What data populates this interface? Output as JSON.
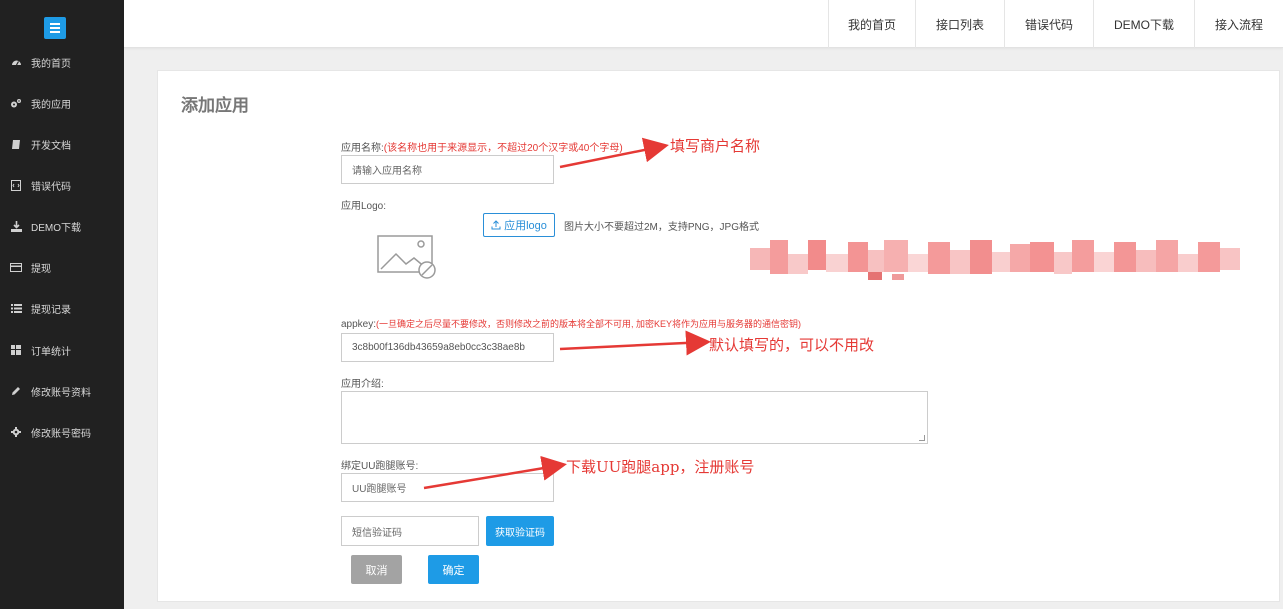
{
  "sidebar": {
    "items": [
      {
        "label": "我的首页",
        "icon": "dashboard-icon"
      },
      {
        "label": "我的应用",
        "icon": "cogs-icon"
      },
      {
        "label": "开发文档",
        "icon": "book-icon"
      },
      {
        "label": "错误代码",
        "icon": "code-file-icon"
      },
      {
        "label": "DEMO下载",
        "icon": "download-icon"
      },
      {
        "label": "提现",
        "icon": "credit-card-icon"
      },
      {
        "label": "提现记录",
        "icon": "list-icon"
      },
      {
        "label": "订单统计",
        "icon": "grid-icon"
      },
      {
        "label": "修改账号资料",
        "icon": "pencil-icon"
      },
      {
        "label": "修改账号密码",
        "icon": "gear-icon"
      }
    ]
  },
  "topnav": {
    "items": [
      "我的首页",
      "接口列表",
      "错误代码",
      "DEMO下载",
      "接入流程"
    ]
  },
  "page": {
    "title": "添加应用"
  },
  "form": {
    "app_name": {
      "label": "应用名称:",
      "note": "(该名称也用于来源显示，不超过20个汉字或40个字母)",
      "placeholder": "请输入应用名称"
    },
    "logo": {
      "label": "应用Logo:",
      "button": "应用logo",
      "hint": "图片大小不要超过2M，支持PNG，JPG格式"
    },
    "appkey": {
      "label": "appkey:",
      "note": "(一旦确定之后尽量不要修改，否则修改之前的版本将全部不可用, 加密KEY将作为应用与服务器的通信密钥)",
      "value": "3c8b00f136db43659a8eb0cc3c38ae8b"
    },
    "intro": {
      "label": "应用介绍:"
    },
    "uu_account": {
      "label": "绑定UU跑腿账号:",
      "placeholder": "UU跑腿账号"
    },
    "sms": {
      "placeholder": "短信验证码",
      "button": "获取验证码"
    },
    "cancel_label": "取消",
    "confirm_label": "确定"
  },
  "annotations": {
    "name": "填写商户名称",
    "appkey": "默认填写的，可以不用改",
    "uu": "下载UU跑腿app，注册账号"
  },
  "colors": {
    "sidebar_bg": "#212121",
    "accent": "#1e9be6",
    "annotation_red": "#e53935",
    "cancel_grey": "#a3a3a3"
  }
}
